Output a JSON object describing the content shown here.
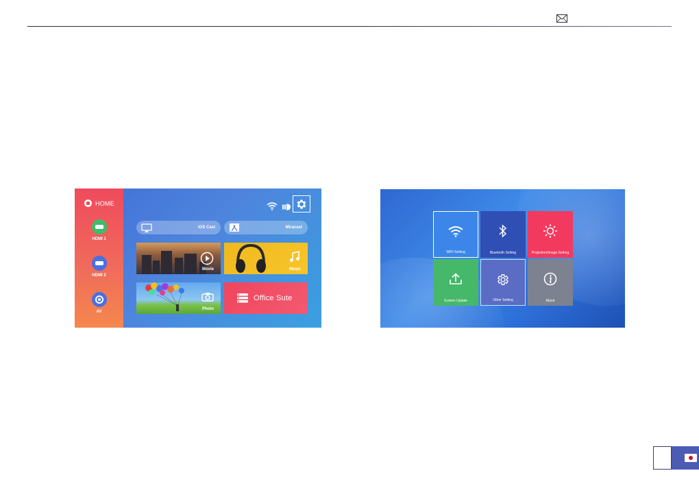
{
  "header": {
    "icon": "envelope-icon"
  },
  "home_screen": {
    "home_label": "HOME",
    "sources": [
      {
        "label": "HDMI 1",
        "icon": "hdmi-icon",
        "color": "#3dbd6a"
      },
      {
        "label": "HDMI 2",
        "icon": "hdmi-icon",
        "color": "#4a6fe0"
      },
      {
        "label": "AV",
        "icon": "av-icon",
        "color": "#4a6fe0"
      }
    ],
    "status_icons": [
      "wifi-icon",
      "ir-icon",
      "gear-icon"
    ],
    "cast_buttons": [
      {
        "label": "iOS Cast",
        "icon": "airplay-icon"
      },
      {
        "label": "Miracast",
        "icon": "miracast-icon"
      }
    ],
    "tiles": {
      "movie": "Movie",
      "music": "Music",
      "photo": "Photo",
      "office": "Office Sute"
    }
  },
  "settings_screen": {
    "tiles": [
      {
        "label": "WIFI Setting",
        "icon": "wifi-icon",
        "color": "#3b86e8"
      },
      {
        "label": "Bluetooth Setting",
        "icon": "bluetooth-icon",
        "color": "#2f4fb4"
      },
      {
        "label": "Projection/Image Setting",
        "icon": "brightness-icon",
        "color": "#f23a5e"
      },
      {
        "label": "System Update",
        "icon": "upload-icon",
        "color": "#45b86a"
      },
      {
        "label": "Other Setting",
        "icon": "gear-icon",
        "color": "#5a6cc4"
      },
      {
        "label": "About",
        "icon": "info-icon",
        "color": "#7d8290"
      }
    ]
  },
  "footer": {
    "flag": "japan-flag"
  }
}
